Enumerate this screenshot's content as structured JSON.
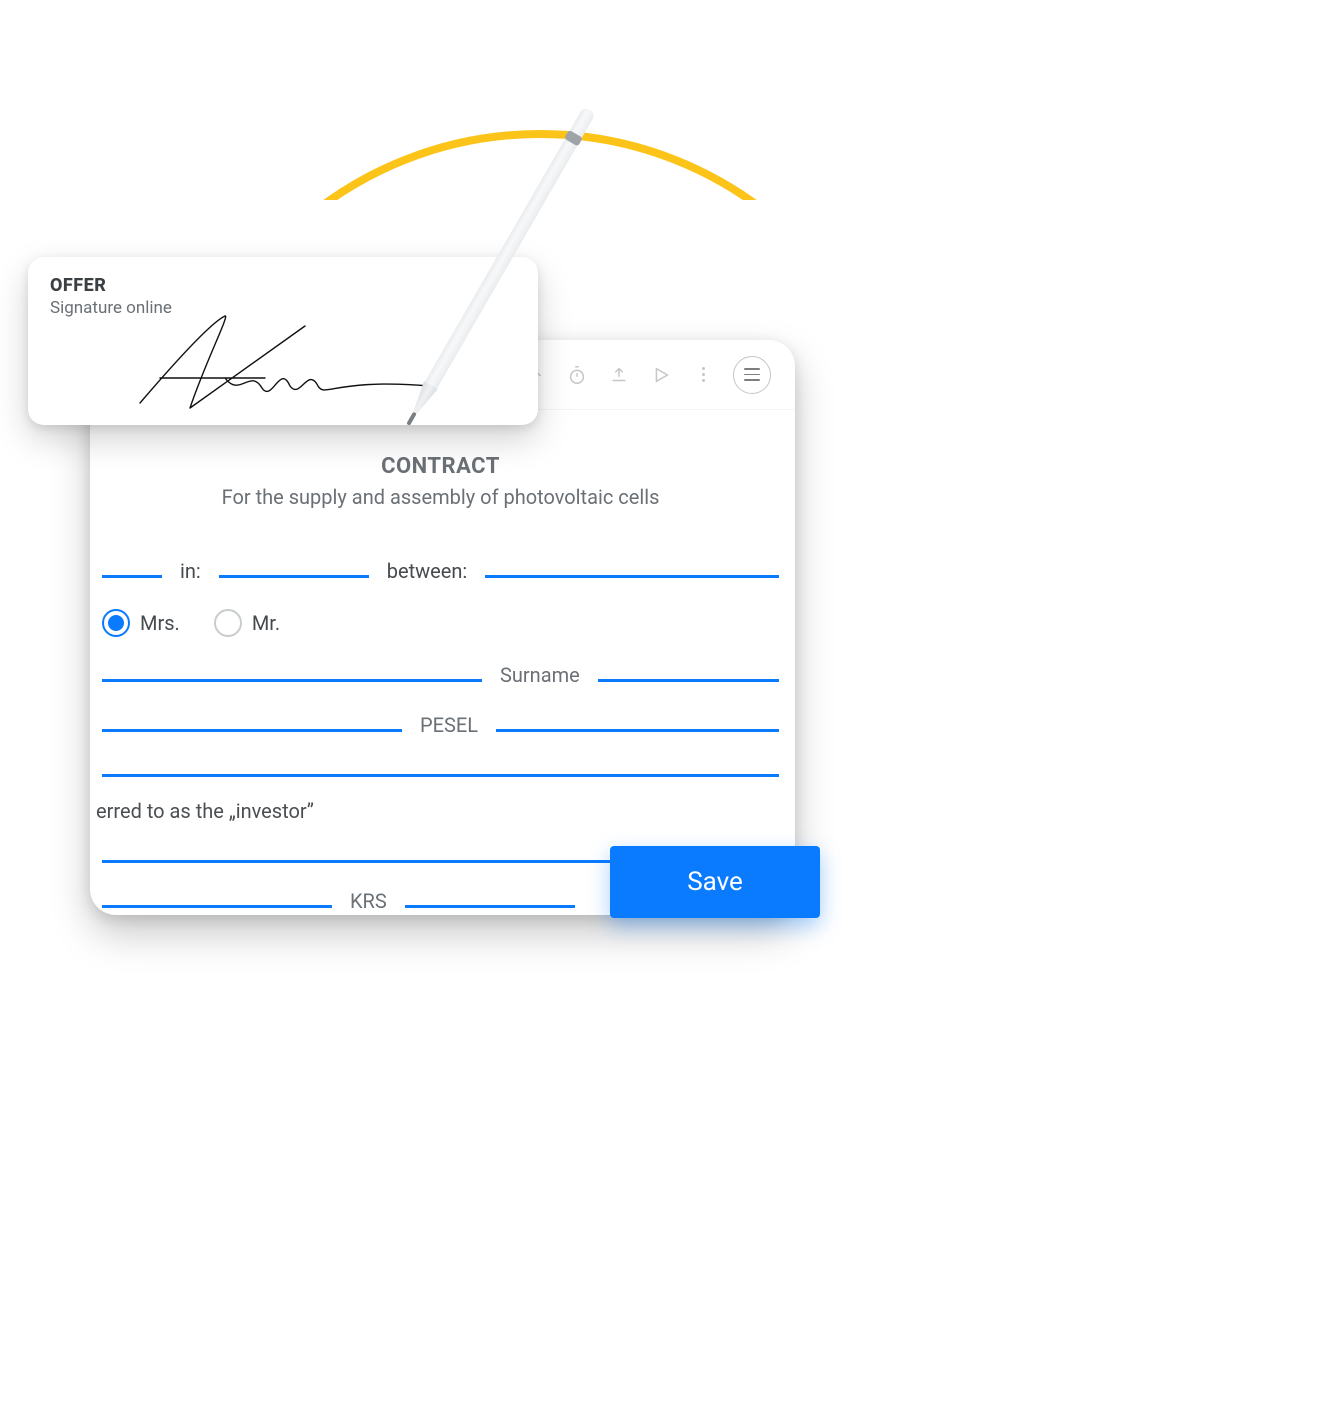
{
  "offer": {
    "title": "OFFER",
    "subtitle": "Signature online"
  },
  "toolbar": {
    "handshake_icon": "handshake-icon",
    "stopwatch_icon": "stopwatch-icon",
    "upload_icon": "upload-icon",
    "play_icon": "play-icon",
    "more_icon": "more-icon",
    "menu_icon": "menu-icon"
  },
  "doc": {
    "title": "CONTRACT",
    "subtitle": "For the supply and assembly of photovoltaic cells",
    "labels": {
      "in": "in:",
      "between": "between:",
      "surname": "Surname",
      "pesel": "PESEL",
      "krs": "KRS",
      "mrs": "Mrs.",
      "mr": "Mr."
    },
    "salutation_selected": "mrs",
    "investor_line": "erred to as the „investor”"
  },
  "actions": {
    "save": "Save"
  }
}
